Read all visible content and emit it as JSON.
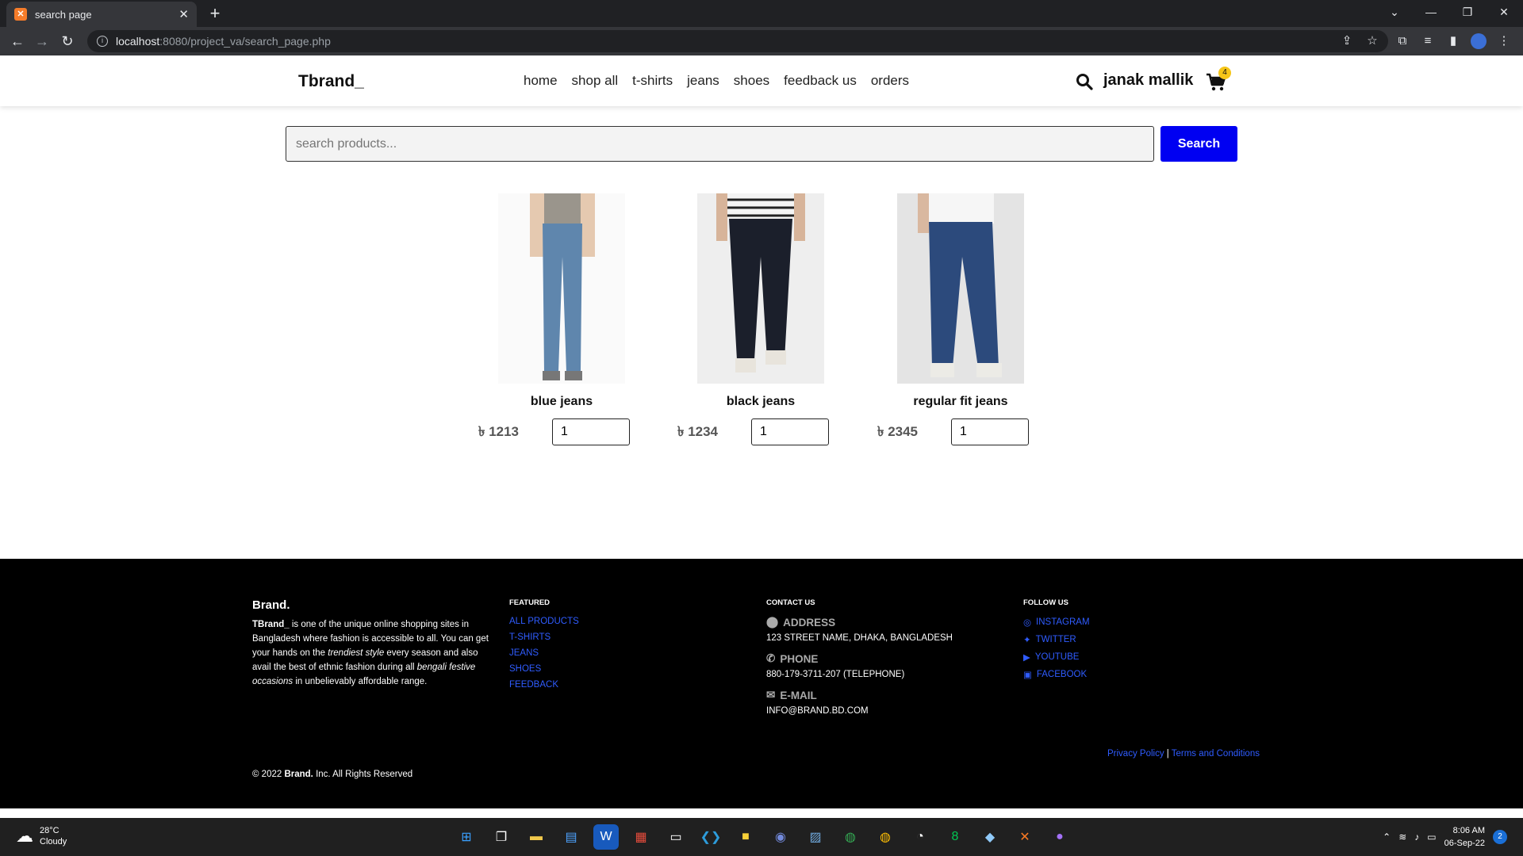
{
  "browser": {
    "tab_title": "search page",
    "url_host": "localhost",
    "url_rest": ":8080/project_va/search_page.php"
  },
  "header": {
    "logo": "Tbrand_",
    "nav": [
      "home",
      "shop all",
      "t-shirts",
      "jeans",
      "shoes",
      "feedback us",
      "orders"
    ],
    "username": "janak mallik",
    "cart_count": "4"
  },
  "search": {
    "placeholder": "search products...",
    "button": "Search"
  },
  "products": [
    {
      "name": "blue jeans",
      "price": "৳ 1213",
      "qty": "1",
      "color": "#5f86ad"
    },
    {
      "name": "black jeans",
      "price": "৳ 1234",
      "qty": "1",
      "color": "#1b1f2b"
    },
    {
      "name": "regular fit jeans",
      "price": "৳ 2345",
      "qty": "1",
      "color": "#2c4a7c"
    }
  ],
  "footer": {
    "brand": "Brand.",
    "desc_bold": "TBrand_",
    "desc_1": " is one of the unique online shopping sites in Bangladesh where fashion is accessible to all. You can get your hands on the ",
    "desc_em1": "trendiest style",
    "desc_2": " every season and also avail the best of ethnic fashion during all ",
    "desc_em2": "bengali festive occasions",
    "desc_3": " in unbelievably affordable range.",
    "featured_title": "FEATURED",
    "featured_links": [
      "ALL PRODUCTS",
      "T-SHIRTS",
      "JEANS",
      "SHOES",
      "FEEDBACK"
    ],
    "contact_title": "CONTACT US",
    "address_label": "ADDRESS",
    "address": "123 STREET NAME, DHAKA, BANGLADESH",
    "phone_label": "PHONE",
    "phone": "880-179-3711-207 (TELEPHONE)",
    "email_label": "E-MAIL",
    "email": "INFO@BRAND.BD.COM",
    "follow_title": "FOLLOW US",
    "social": [
      "INSTAGRAM",
      "TWITTER",
      "YOUTUBE",
      "FACEBOOK"
    ],
    "privacy": "Privacy Policy",
    "terms": "Terms and Conditions",
    "copy_pre": "© 2022 ",
    "copy_brand": "Brand.",
    "copy_post": " Inc. All Rights Reserved"
  },
  "taskbar": {
    "temp": "28°C",
    "condition": "Cloudy",
    "time": "8:06 AM",
    "date": "06-Sep-22",
    "notifications": "2"
  }
}
